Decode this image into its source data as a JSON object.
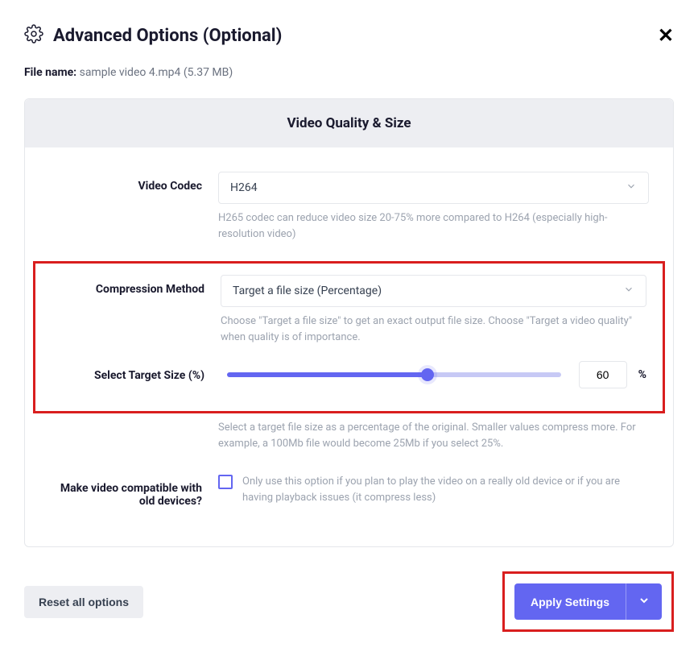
{
  "header": {
    "title": "Advanced Options (Optional)"
  },
  "file": {
    "label": "File name:",
    "value": "sample video 4.mp4 (5.37 MB)"
  },
  "section": {
    "title": "Video Quality & Size"
  },
  "codec": {
    "label": "Video Codec",
    "value": "H264",
    "help": "H265 codec can reduce video size 20-75% more compared to H264 (especially high-resolution video)"
  },
  "compression": {
    "label": "Compression Method",
    "value": "Target a file size (Percentage)",
    "help": "Choose \"Target a file size\" to get an exact output file size. Choose \"Target a video quality\" when quality is of importance."
  },
  "targetSize": {
    "label": "Select Target Size (%)",
    "value": "60",
    "unit": "%",
    "help": "Select a target file size as a percentage of the original. Smaller values compress more. For example, a 100Mb file would become 25Mb if you select 25%."
  },
  "compat": {
    "label": "Make video compatible with old devices?",
    "text": "Only use this option if you plan to play the video on a really old device or if you are having playback issues (it compress less)"
  },
  "footer": {
    "reset": "Reset all options",
    "apply": "Apply Settings"
  }
}
